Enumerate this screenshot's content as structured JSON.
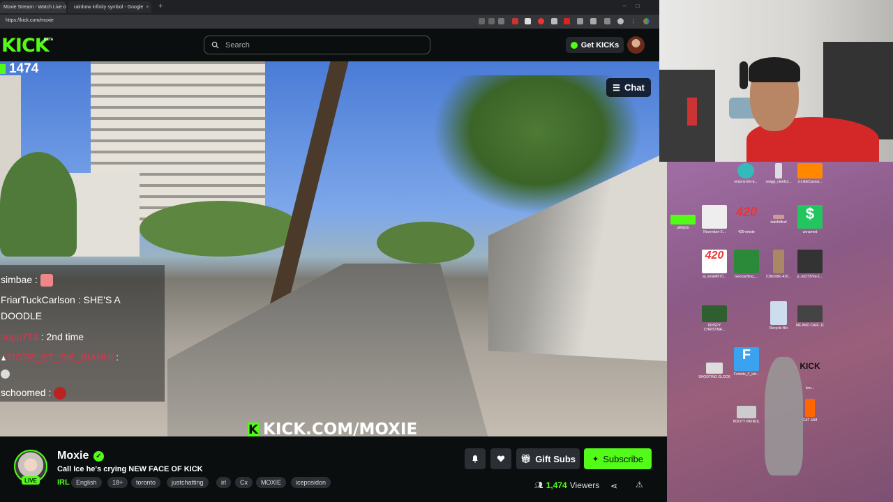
{
  "browser": {
    "tabs": [
      {
        "title": "Moxie Stream - Watch Live o"
      },
      {
        "title": "rainbow infinity symbol - Google"
      }
    ],
    "new_tab": "+",
    "url": "https://kick.com/moxie"
  },
  "header": {
    "logo": "KICK",
    "beta": "BETA",
    "search_placeholder": "Search",
    "get_kicks": "Get KICKs"
  },
  "video": {
    "viewer_count": "1474",
    "chat_button": "Chat",
    "chat_messages": [
      {
        "user": "simbae",
        "sep": " : ",
        "text": ""
      },
      {
        "user": "FriarTuckCarlson",
        "sep": " : ",
        "text": "SHE'S A"
      },
      {
        "user": "",
        "sep": "",
        "text": "DOODLE"
      },
      {
        "user": "supp713",
        "sep": " : ",
        "text": "2nd time"
      },
      {
        "user": "TIGRE_ET_SIE_BIANHI",
        "sep": " :",
        "text": ""
      },
      {
        "user": "schoomed",
        "sep": " : ",
        "text": ""
      }
    ],
    "watermark": "KICK.COM/MOXIE"
  },
  "stream": {
    "name": "Moxie",
    "live": "LIVE",
    "title": "Call Ice he's crying NEW FACE OF KICK",
    "category": "IRL",
    "tags": [
      "English",
      "18+",
      "toronto",
      "justchatting",
      "irl",
      "Cx",
      "MOXIE",
      "iceposidon"
    ],
    "gift_subs": "Gift Subs",
    "subscribe": "Subscribe",
    "viewers_count": "1,474",
    "viewers_label": "Viewers"
  },
  "desktop": {
    "icons": [
      "what-is-the-b...",
      "swiggi_cteefs1...",
      "2-LittleCaesar...",
      "pillhjitck",
      "November-2...",
      "420-emote",
      "dab4fdfcef",
      "unnamed",
      "at_small4570...",
      "Geocaching_...",
      "518e3d6c-420...",
      "p_ret2737ee-1...",
      "KRISPY CHRISTMA...",
      "Recycle Bin",
      "ME AND CARL 11",
      "SHOOTING GLOCK",
      "Fortnite_F_lett...",
      "lem...",
      "BOOTY PATROL",
      "CAT JAM"
    ]
  },
  "colors": {
    "accent": "#53fc18",
    "background": "#0b0e0f"
  }
}
